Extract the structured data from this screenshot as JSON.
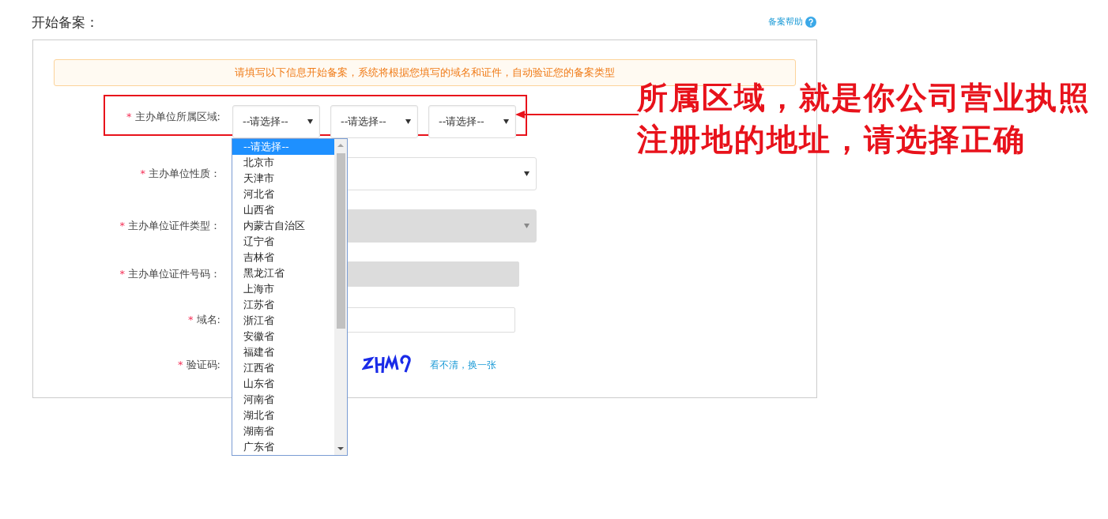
{
  "title": "开始备案：",
  "help_link": "备案帮助",
  "notice": "请填写以下信息开始备案，系统将根据您填写的域名和证件，自动验证您的备案类型",
  "rows": [
    {
      "kind": "region",
      "mark": "*",
      "label": "主办单位所属区域:",
      "selects": [
        "--请选择--",
        "--请选择--",
        "--请选择--"
      ],
      "highlighted": true
    },
    {
      "kind": "select",
      "mark": "*",
      "label": "主办单位性质：",
      "disabled": false
    },
    {
      "kind": "select",
      "mark": "*",
      "label": "主办单位证件类型：",
      "disabled": true
    },
    {
      "kind": "input",
      "mark": "*",
      "label": "主办单位证件号码：",
      "disabled": true
    },
    {
      "kind": "input",
      "mark": "*",
      "label": "域名:",
      "disabled": false
    },
    {
      "kind": "captcha",
      "mark": "*",
      "label": "验证码:",
      "refresh_link": "看不清，换一张"
    }
  ],
  "dropdown": {
    "items": [
      {
        "label": "--请选择--",
        "selected": true
      },
      {
        "label": "北京市",
        "selected": false
      },
      {
        "label": "天津市",
        "selected": false
      },
      {
        "label": "河北省",
        "selected": false
      },
      {
        "label": "山西省",
        "selected": false
      },
      {
        "label": "内蒙古自治区",
        "selected": false
      },
      {
        "label": "辽宁省",
        "selected": false
      },
      {
        "label": "吉林省",
        "selected": false
      },
      {
        "label": "黑龙江省",
        "selected": false
      },
      {
        "label": "上海市",
        "selected": false
      },
      {
        "label": "江苏省",
        "selected": false
      },
      {
        "label": "浙江省",
        "selected": false
      },
      {
        "label": "安徽省",
        "selected": false
      },
      {
        "label": "福建省",
        "selected": false
      },
      {
        "label": "江西省",
        "selected": false
      },
      {
        "label": "山东省",
        "selected": false
      },
      {
        "label": "河南省",
        "selected": false
      },
      {
        "label": "湖北省",
        "selected": false
      },
      {
        "label": "湖南省",
        "selected": false
      },
      {
        "label": "广东省",
        "selected": false
      }
    ]
  },
  "annotation": [
    "所属区域，就是你公司营业执照",
    "注册地的地址，请选择正确"
  ]
}
